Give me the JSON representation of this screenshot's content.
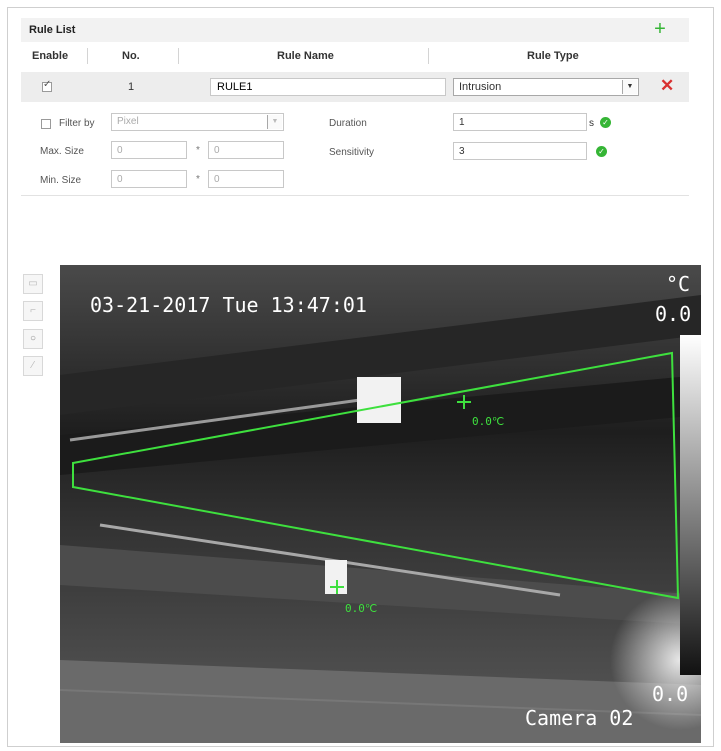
{
  "rule_list": {
    "title": "Rule List",
    "add_icon": "plus-icon",
    "columns": {
      "enable": "Enable",
      "no": "No.",
      "rule_name": "Rule Name",
      "rule_type": "Rule Type"
    },
    "rules": [
      {
        "enabled": true,
        "no": "1",
        "name": "RULE1",
        "type": "Intrusion",
        "delete_icon": "delete-x-icon"
      }
    ]
  },
  "settings": {
    "filter_by_label": "Filter by",
    "filter_by_checked": false,
    "filter_by_value": "Pixel",
    "max_size_label": "Max. Size",
    "max_w": "0",
    "max_h": "0",
    "min_size_label": "Min. Size",
    "min_w": "0",
    "min_h": "0",
    "times": "*",
    "duration_label": "Duration",
    "duration_value": "1",
    "duration_unit": "s",
    "sensitivity_label": "Sensitivity",
    "sensitivity_value": "3"
  },
  "toolbar": {
    "icons": [
      "draw-rectangle-icon",
      "draw-polygon-icon",
      "draw-circle-icon",
      "clear-icon"
    ]
  },
  "video": {
    "timestamp": "03-21-2017 Tue 13:47:01",
    "unit": "°C",
    "max_temp": "0.0",
    "min_temp": "0.0",
    "camera_name": "Camera 02",
    "point_temp_1": "0.0℃",
    "point_temp_2": "0.0℃",
    "accent_color": "#3ee03e"
  }
}
